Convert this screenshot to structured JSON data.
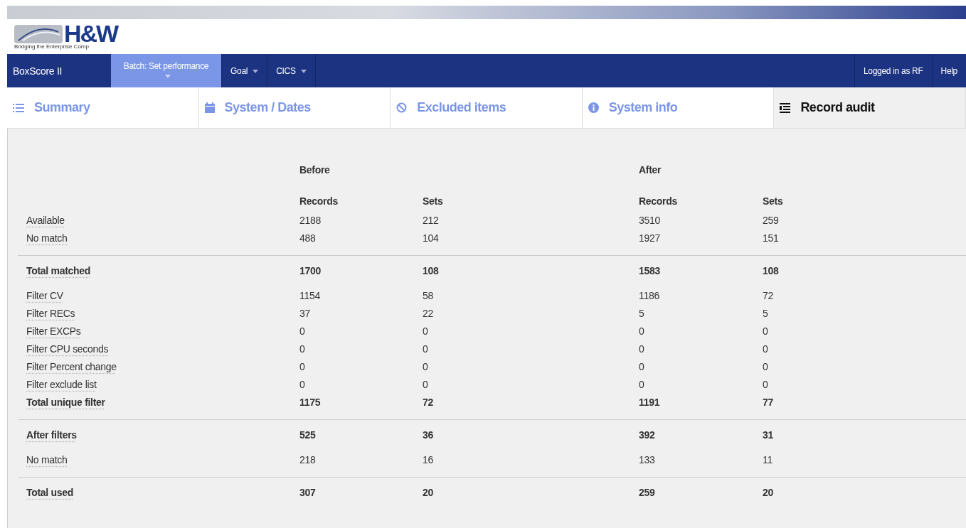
{
  "logo": {
    "mark": "H&W",
    "tagline": "Bridging the Enterprise Comp"
  },
  "nav": {
    "brand": "BoxScore II",
    "menus": [
      {
        "label": "Batch:  Set performance",
        "selected": true
      },
      {
        "label": "Goal",
        "selected": false
      },
      {
        "label": "CICS",
        "selected": false
      }
    ],
    "right": [
      "Logged in as RF",
      "Help"
    ]
  },
  "tabs": [
    {
      "label": "Summary",
      "selected": false
    },
    {
      "label": "System / Dates",
      "selected": false
    },
    {
      "label": "Excluded items",
      "selected": false
    },
    {
      "label": "System info",
      "selected": false
    },
    {
      "label": "Record audit",
      "selected": true
    }
  ],
  "table": {
    "groups_header": [
      "Before",
      "After"
    ],
    "columns": [
      "Records",
      "Sets",
      "Records",
      "Sets"
    ],
    "groups": [
      {
        "ruled": false,
        "rows": [
          {
            "label": "Available",
            "bold": false,
            "values": [
              "2188",
              "212",
              "3510",
              "259"
            ]
          },
          {
            "label": "No match",
            "bold": false,
            "values": [
              "488",
              "104",
              "1927",
              "151"
            ]
          }
        ]
      },
      {
        "ruled": true,
        "rows": [
          {
            "label": "Total matched",
            "bold": true,
            "values": [
              "1700",
              "108",
              "1583",
              "108"
            ]
          }
        ]
      },
      {
        "ruled": false,
        "rows": [
          {
            "label": "Filter CV",
            "bold": false,
            "values": [
              "1154",
              "58",
              "1186",
              "72"
            ]
          },
          {
            "label": "Filter RECs",
            "bold": false,
            "values": [
              "37",
              "22",
              "5",
              "5"
            ]
          },
          {
            "label": "Filter EXCPs",
            "bold": false,
            "values": [
              "0",
              "0",
              "0",
              "0"
            ]
          },
          {
            "label": "Filter CPU seconds",
            "bold": false,
            "values": [
              "0",
              "0",
              "0",
              "0"
            ]
          },
          {
            "label": "Filter Percent change",
            "bold": false,
            "values": [
              "0",
              "0",
              "0",
              "0"
            ]
          },
          {
            "label": "Filter exclude list",
            "bold": false,
            "values": [
              "0",
              "0",
              "0",
              "0"
            ]
          },
          {
            "label": "Total unique filter",
            "bold": true,
            "values": [
              "1175",
              "72",
              "1191",
              "77"
            ]
          }
        ]
      },
      {
        "ruled": true,
        "rows": [
          {
            "label": "After filters",
            "bold": true,
            "values": [
              "525",
              "36",
              "392",
              "31"
            ]
          }
        ]
      },
      {
        "ruled": false,
        "rows": [
          {
            "label": "No match",
            "bold": false,
            "values": [
              "218",
              "16",
              "133",
              "11"
            ]
          }
        ]
      },
      {
        "ruled": true,
        "rows": [
          {
            "label": "Total used",
            "bold": true,
            "values": [
              "307",
              "20",
              "259",
              "20"
            ]
          }
        ]
      }
    ]
  }
}
